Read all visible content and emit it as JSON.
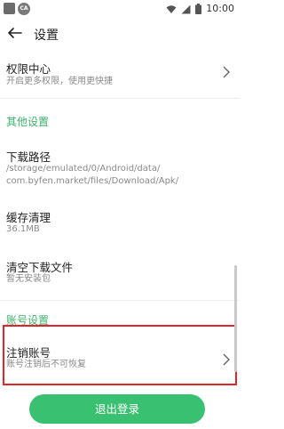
{
  "status_bar": {
    "time": "10:00",
    "badge_text": "CA"
  },
  "header": {
    "title": "设置"
  },
  "settings": [
    {
      "title": "权限中心",
      "subtitle": "开启更多权限，使用更快捷"
    }
  ],
  "sections": {
    "other": "其他设置",
    "account": "账号设置"
  },
  "other_items": {
    "download_path": {
      "title": "下载路径",
      "line1": "/storage/emulated/0/Android/data/",
      "line2": "com.byfen.market/files/Download/Apk/"
    },
    "cache": {
      "title": "缓存清理",
      "subtitle": "36.1MB"
    },
    "clear_downloads": {
      "title": "清空下载文件",
      "subtitle": "暂无安装包"
    }
  },
  "account_items": {
    "cancel_account": {
      "title": "注销账号",
      "subtitle": "账号注销后不可恢复"
    }
  },
  "logout_label": "退出登录",
  "colors": {
    "accent": "#39c071",
    "section": "#3fb36b",
    "highlight": "#e0262a"
  }
}
